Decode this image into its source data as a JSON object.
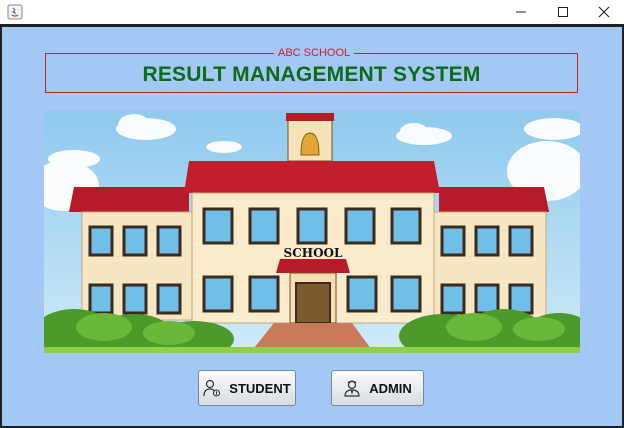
{
  "window": {
    "controls": {
      "minimize_icon": "minimize-icon",
      "maximize_icon": "maximize-icon",
      "close_icon": "close-icon"
    }
  },
  "header": {
    "school_name": "ABC SCHOOL",
    "title": "RESULT MANAGEMENT SYSTEM"
  },
  "banner": {
    "sign_text": "SCHOOL"
  },
  "buttons": {
    "student_label": "STUDENT",
    "admin_label": "ADMIN"
  },
  "colors": {
    "background": "#a3c8f5",
    "title_green": "#0f6b1c",
    "border_red": "#c8202a"
  }
}
